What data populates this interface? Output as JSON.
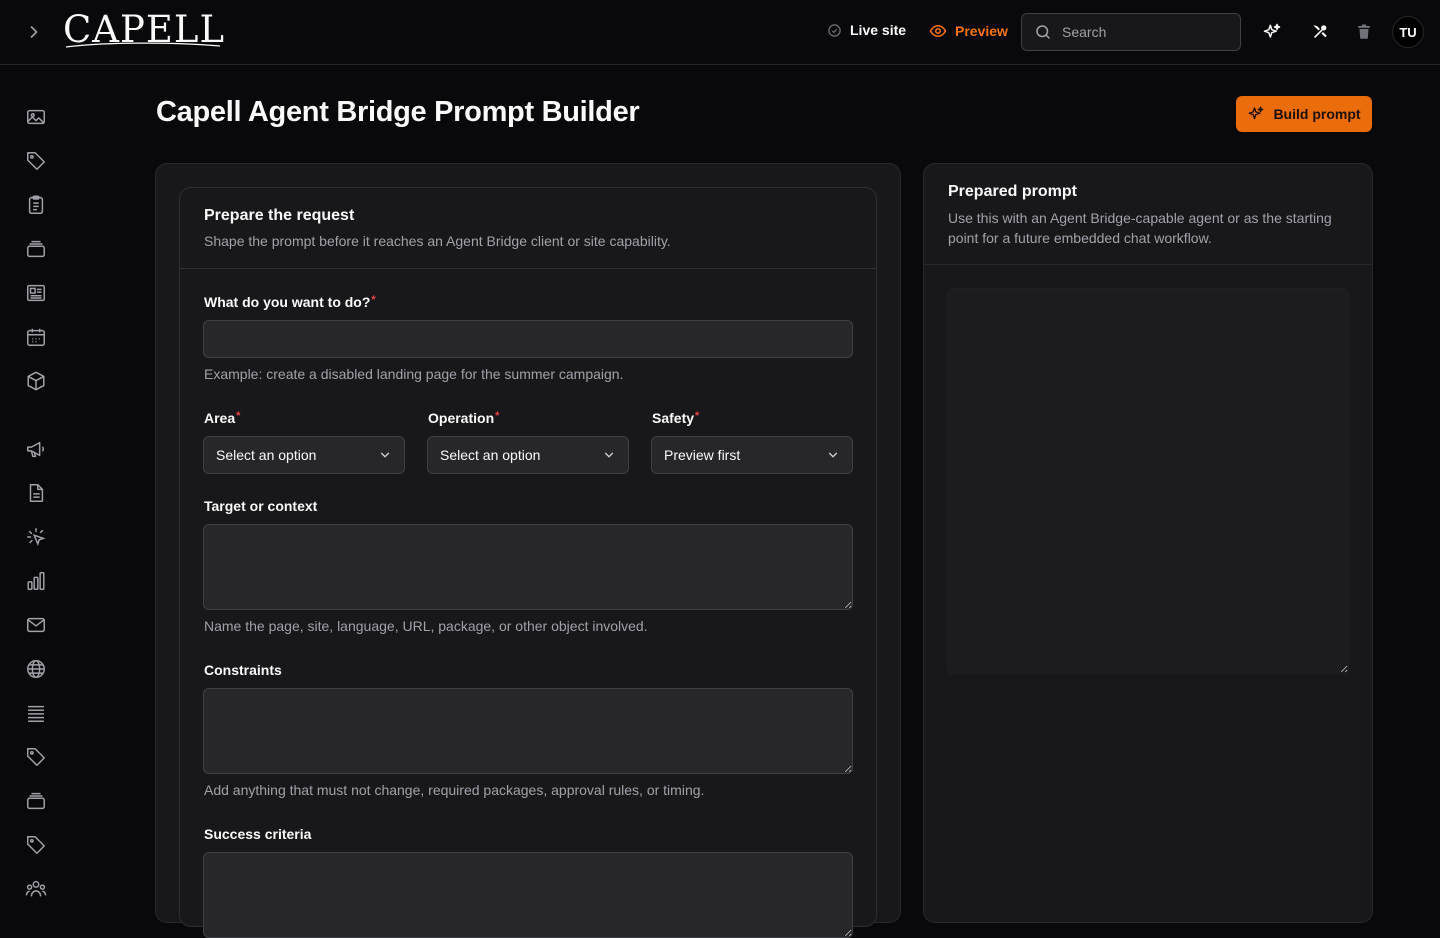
{
  "topbar": {
    "logo_text": "CAPELL",
    "live_site_label": "Live site",
    "preview_label": "Preview",
    "search_placeholder": "Search",
    "avatar_initials": "TU",
    "icons": [
      "chevron-right-icon",
      "circle-check-icon",
      "eye-icon",
      "search-icon",
      "sparkles-icon",
      "tools-icon",
      "trash-icon"
    ]
  },
  "sidebar": {
    "items": [
      {
        "icon": "image-icon"
      },
      {
        "icon": "tag-icon"
      },
      {
        "icon": "clipboard-list-icon"
      },
      {
        "icon": "stack-icon"
      },
      {
        "icon": "newspaper-icon"
      },
      {
        "icon": "calendar-icon"
      },
      {
        "icon": "cube-icon"
      },
      {
        "icon": "megaphone-icon"
      },
      {
        "icon": "document-icon"
      },
      {
        "icon": "cursor-click-icon"
      },
      {
        "icon": "bar-chart-icon"
      },
      {
        "icon": "mail-icon"
      },
      {
        "icon": "globe-icon"
      },
      {
        "icon": "list-lines-icon"
      },
      {
        "icon": "tag-icon"
      },
      {
        "icon": "stack-icon"
      },
      {
        "icon": "tag-icon"
      },
      {
        "icon": "users-icon"
      }
    ]
  },
  "page": {
    "title": "Capell Agent Bridge Prompt Builder",
    "build_button_label": "Build prompt"
  },
  "form": {
    "title": "Prepare the request",
    "description": "Shape the prompt before it reaches an Agent Bridge client or site capability.",
    "goal": {
      "label": "What do you want to do?",
      "value": "",
      "helper": "Example: create a disabled landing page for the summer campaign."
    },
    "area": {
      "label": "Area",
      "selected": "Select an option"
    },
    "operation": {
      "label": "Operation",
      "selected": "Select an option"
    },
    "safety": {
      "label": "Safety",
      "selected": "Preview first"
    },
    "target": {
      "label": "Target or context",
      "value": "",
      "helper": "Name the page, site, language, URL, package, or other object involved."
    },
    "constraints": {
      "label": "Constraints",
      "value": "",
      "helper": "Add anything that must not change, required packages, approval rules, or timing."
    },
    "success": {
      "label": "Success criteria",
      "value": ""
    }
  },
  "prepared": {
    "title": "Prepared prompt",
    "description": "Use this with an Agent Bridge-capable agent or as the starting point for a future embedded chat workflow.",
    "value": ""
  },
  "colors": {
    "accent": "#f97316",
    "accent_button": "#ea6c0a",
    "required": "#ef4444",
    "background": "#09090b",
    "panel": "#18181b"
  }
}
